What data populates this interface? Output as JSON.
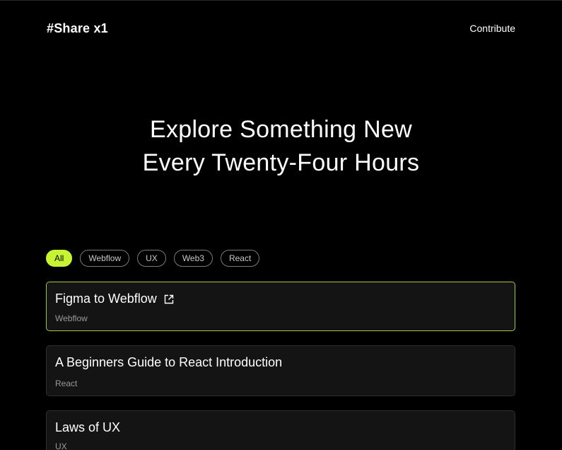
{
  "header": {
    "logo": "#Share x1",
    "contribute_label": "Contribute"
  },
  "hero": {
    "line1": "Explore Something New",
    "line2": "Every Twenty-Four Hours"
  },
  "filters": {
    "items": [
      {
        "label": "All",
        "active": true
      },
      {
        "label": "Webflow",
        "active": false
      },
      {
        "label": "UX",
        "active": false
      },
      {
        "label": "Web3",
        "active": false
      },
      {
        "label": "React",
        "active": false
      }
    ]
  },
  "cards": [
    {
      "title": "Figma to Webflow",
      "tag": "Webflow",
      "icon": "external-link-icon",
      "highlighted": true
    },
    {
      "title": "A Beginners Guide to React Introduction",
      "tag": "React"
    },
    {
      "title": "Laws of UX",
      "tag": "UX"
    }
  ],
  "colors": {
    "background": "#000000",
    "accent": "#c6f432",
    "card_background": "#141414",
    "highlight_border": "#a4c93a"
  }
}
